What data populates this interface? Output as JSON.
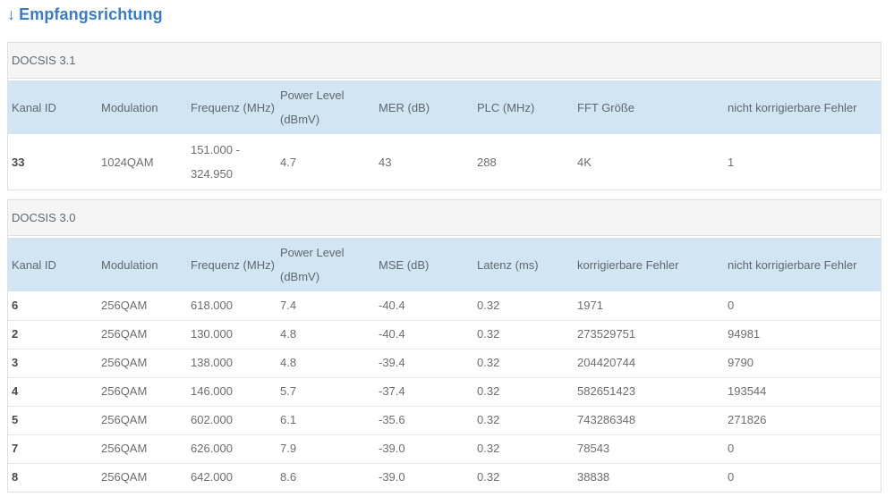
{
  "heading": {
    "arrow": "↓",
    "label": "Empfangsrichtung"
  },
  "colors": {
    "accent": "#3a7cc4",
    "table-header-bg": "#d2e5f2",
    "section-bg": "#f5f5f5",
    "border": "#e0e0e0",
    "row-border": "#e8e8e8",
    "text": "#6e6e6e",
    "text-dark": "#4a4a4a",
    "header-text": "#5f686e"
  },
  "tables": [
    {
      "section": "DOCSIS 3.1",
      "columns": [
        "Kanal ID",
        "Modulation",
        "Frequenz (MHz)",
        "Power Level (dBmV)",
        "MER (dB)",
        "PLC (MHz)",
        "FFT Größe",
        "nicht korrigierbare Fehler"
      ],
      "rows": [
        [
          "33",
          "1024QAM",
          "151.000 - 324.950",
          "4.7",
          "43",
          "288",
          "4K",
          "1"
        ]
      ]
    },
    {
      "section": "DOCSIS 3.0",
      "columns": [
        "Kanal ID",
        "Modulation",
        "Frequenz (MHz)",
        "Power Level (dBmV)",
        "MSE (dB)",
        "Latenz (ms)",
        "korrigierbare Fehler",
        "nicht korrigierbare Fehler"
      ],
      "rows": [
        [
          "6",
          "256QAM",
          "618.000",
          "7.4",
          "-40.4",
          "0.32",
          "1971",
          "0"
        ],
        [
          "2",
          "256QAM",
          "130.000",
          "4.8",
          "-40.4",
          "0.32",
          "273529751",
          "94981"
        ],
        [
          "3",
          "256QAM",
          "138.000",
          "4.8",
          "-39.4",
          "0.32",
          "204420744",
          "9790"
        ],
        [
          "4",
          "256QAM",
          "146.000",
          "5.7",
          "-37.4",
          "0.32",
          "582651423",
          "193544"
        ],
        [
          "5",
          "256QAM",
          "602.000",
          "6.1",
          "-35.6",
          "0.32",
          "743286348",
          "271826"
        ],
        [
          "7",
          "256QAM",
          "626.000",
          "7.9",
          "-39.0",
          "0.32",
          "78543",
          "0"
        ],
        [
          "8",
          "256QAM",
          "642.000",
          "8.6",
          "-39.0",
          "0.32",
          "38838",
          "0"
        ]
      ]
    }
  ]
}
